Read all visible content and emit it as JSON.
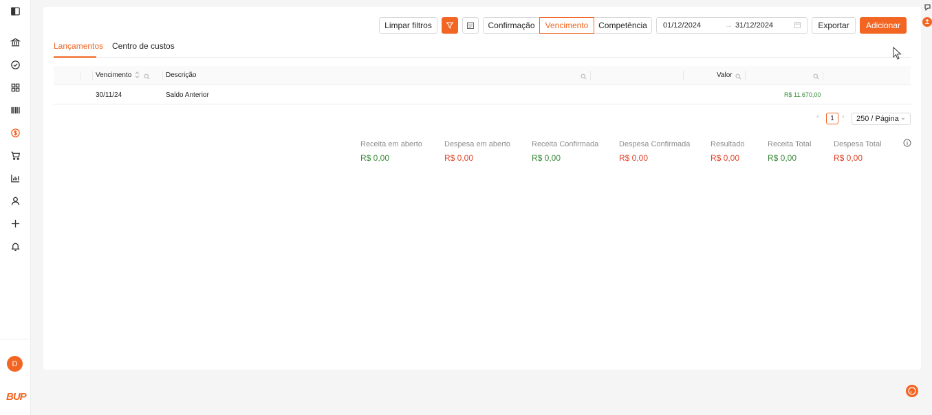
{
  "sidebar": {
    "items": [
      {
        "name": "sidebar-toggle-icon"
      },
      {
        "name": "bank-icon"
      },
      {
        "name": "check-circle-icon"
      },
      {
        "name": "grid-icon"
      },
      {
        "name": "barcode-icon"
      },
      {
        "name": "dollar-circle-icon",
        "active": true
      },
      {
        "name": "cart-icon"
      },
      {
        "name": "bar-chart-icon"
      },
      {
        "name": "user-icon"
      },
      {
        "name": "plus-icon"
      },
      {
        "name": "bell-icon"
      }
    ],
    "avatar_letter": "D",
    "logo_text": "BUP"
  },
  "toolbar": {
    "clear_filters": "Limpar filtros",
    "date_modes": [
      "Confirmação",
      "Vencimento",
      "Competência"
    ],
    "selected_date_mode": "Vencimento",
    "date_from": "01/12/2024",
    "date_to": "31/12/2024",
    "export_label": "Exportar",
    "add_label": "Adicionar"
  },
  "tabs": [
    {
      "label": "Lançamentos",
      "active": true
    },
    {
      "label": "Centro de custos",
      "active": false
    }
  ],
  "table": {
    "columns": {
      "due": "Vencimento",
      "description": "Descrição",
      "value": "Valor"
    },
    "rows": [
      {
        "due": "30/11/24",
        "description": "Saldo Anterior",
        "amount": "R$ 11.670,00"
      }
    ]
  },
  "pagination": {
    "current_page": "1",
    "page_size": "250 / Página"
  },
  "summary": [
    {
      "label": "Receita em aberto",
      "value": "R$ 0,00",
      "tone": "g"
    },
    {
      "label": "Despesa em aberto",
      "value": "R$ 0,00",
      "tone": "r"
    },
    {
      "label": "Receita Confirmada",
      "value": "R$ 0,00",
      "tone": "g"
    },
    {
      "label": "Despesa Confirmada",
      "value": "R$ 0,00",
      "tone": "r"
    },
    {
      "label": "Resultado",
      "value": "R$ 0,00",
      "tone": "r"
    },
    {
      "label": "Receita Total",
      "value": "R$ 0,00",
      "tone": "g"
    },
    {
      "label": "Despesa Total",
      "value": "R$ 0,00",
      "tone": "r"
    }
  ],
  "colors": {
    "accent": "#f26522",
    "positive": "#3a8a3a",
    "negative": "#e0442a"
  }
}
